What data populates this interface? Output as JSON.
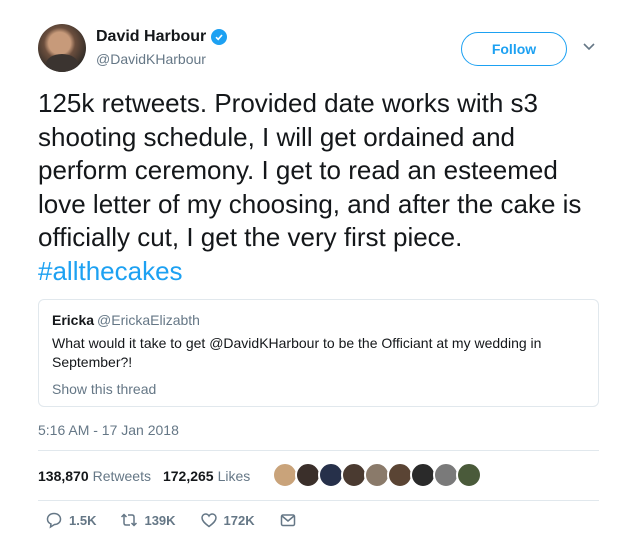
{
  "author": {
    "display_name": "David Harbour",
    "handle": "@DavidKHarbour",
    "follow_label": "Follow"
  },
  "tweet": {
    "text": "125k retweets.  Provided date works with s3 shooting schedule, I will get ordained and perform ceremony.  I get to read an esteemed love letter of my choosing, and after the cake is officially cut, I get the very first piece. ",
    "hashtag": "#allthecakes",
    "timestamp": "5:16 AM - 17 Jan 2018"
  },
  "quoted_tweet": {
    "name": "Ericka",
    "handle": "@ErickaElizabth",
    "text": "What would it take to get @DavidKHarbour to be the Officiant at my wedding in September?!",
    "thread_link": "Show this thread"
  },
  "stats": {
    "retweets_count": "138,870",
    "retweets_label": "Retweets",
    "likes_count": "172,265",
    "likes_label": "Likes"
  },
  "likers": [
    "#c9a37a",
    "#3a2f2a",
    "#26304a",
    "#4a3a30",
    "#8a7a6a",
    "#5a4434",
    "#2a2a2a",
    "#7a7a7a",
    "#4a5a3a"
  ],
  "actions": {
    "replies": "1.5K",
    "retweets": "139K",
    "likes": "172K"
  },
  "colors": {
    "accent": "#1da1f2",
    "secondary_text": "#657786",
    "border": "#e1e8ed"
  }
}
